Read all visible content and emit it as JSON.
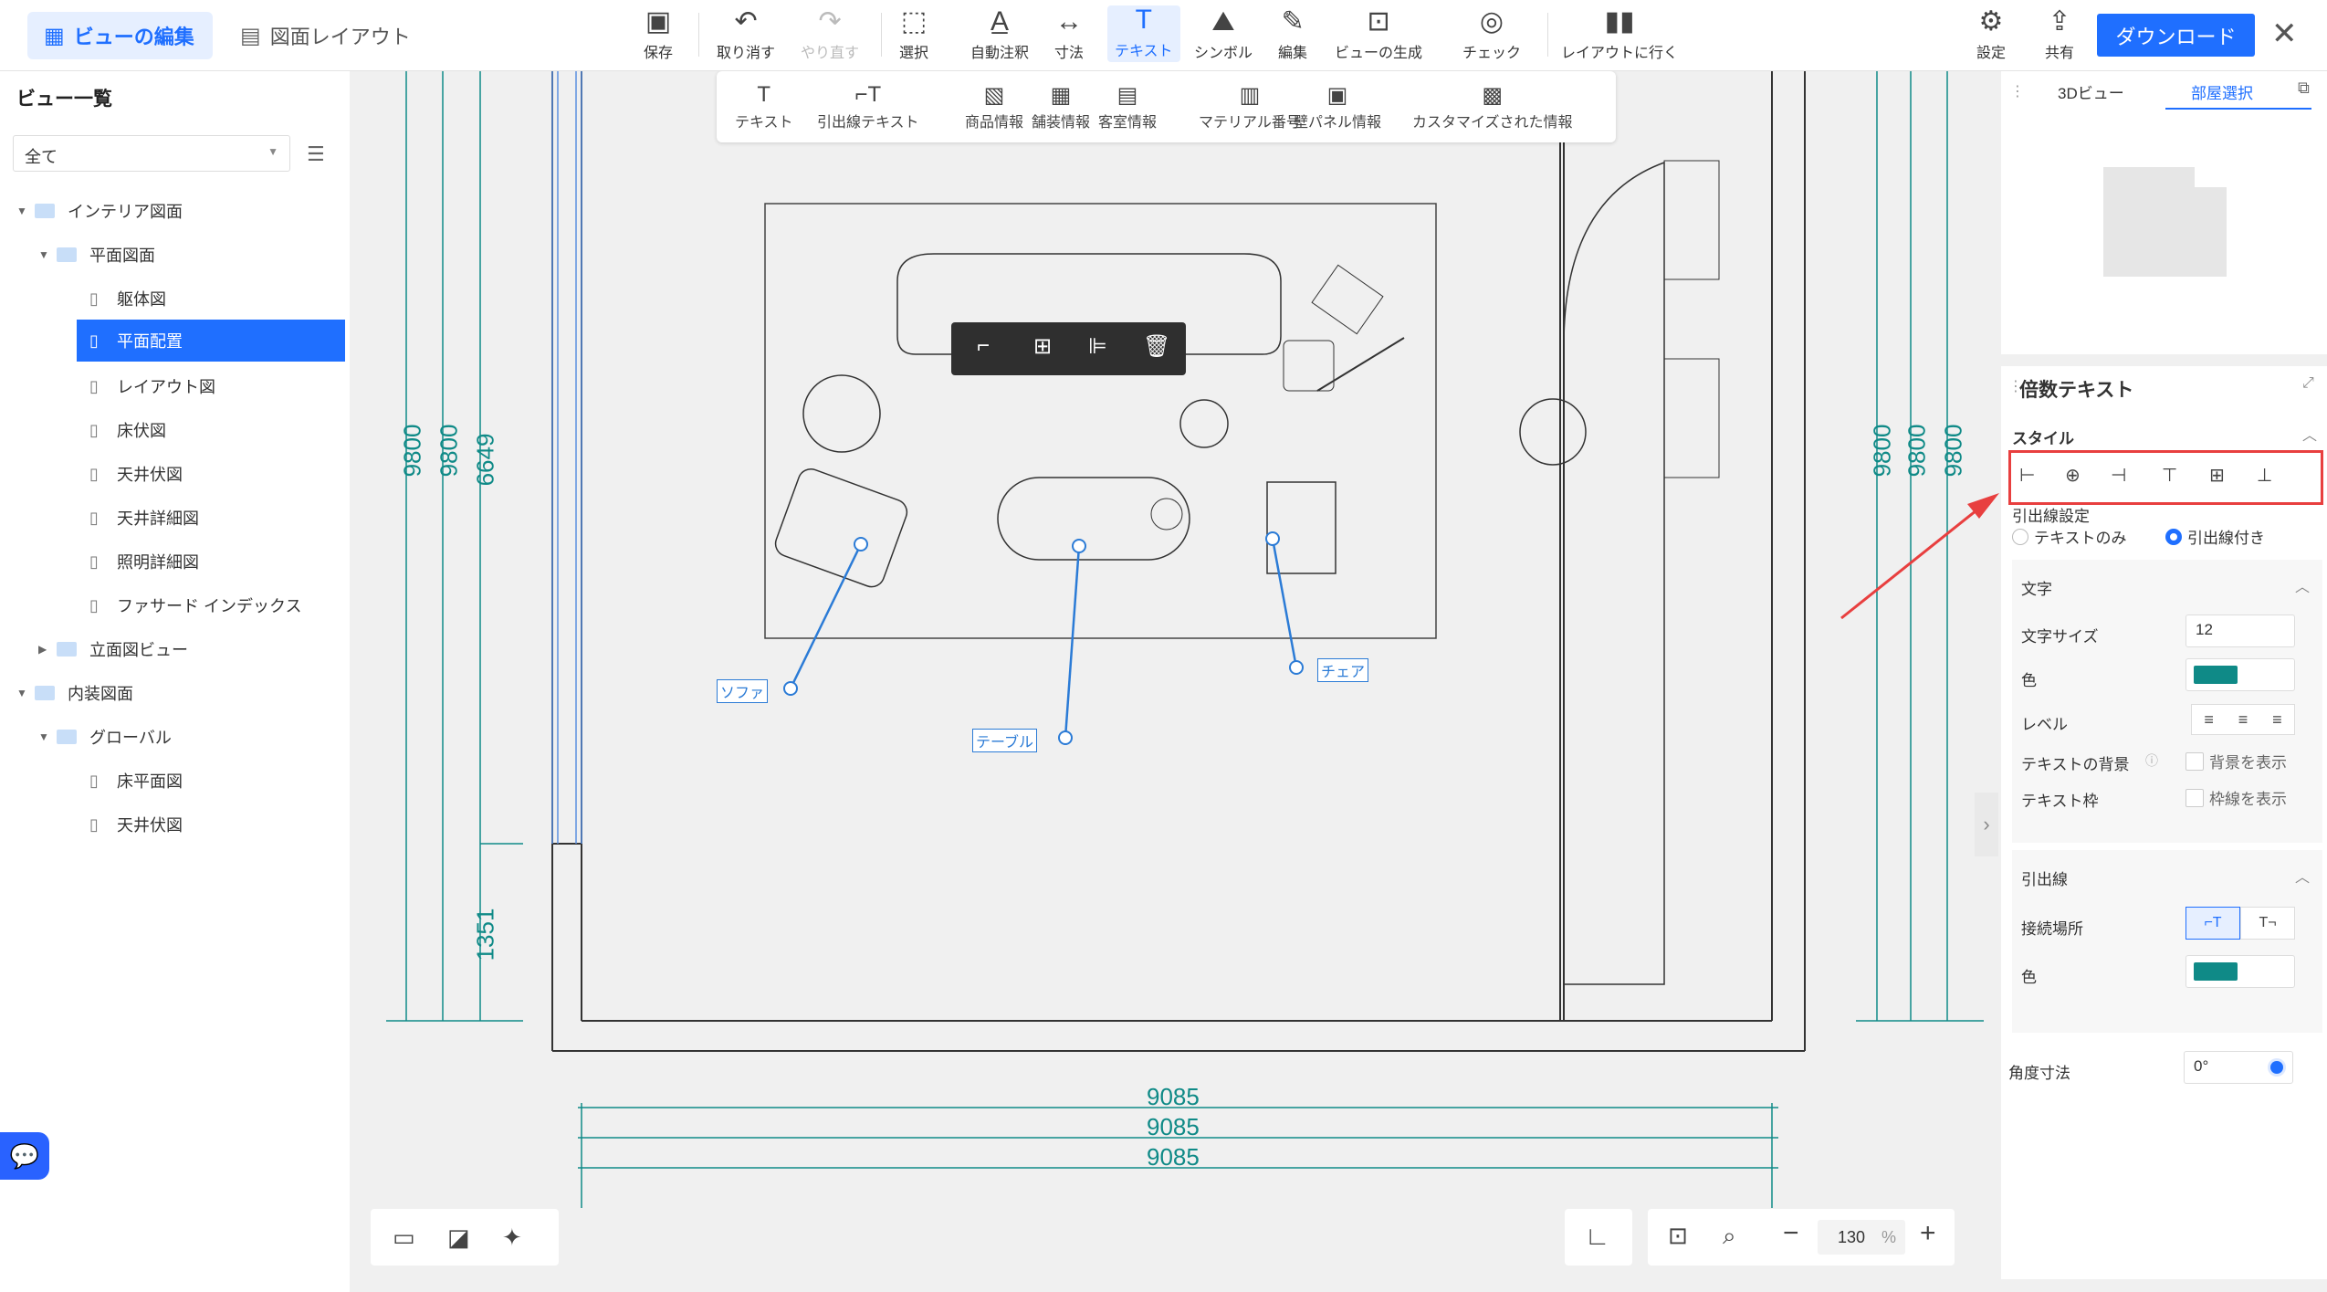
{
  "header": {
    "tab_edit": "ビューの編集",
    "tab_layout": "図面レイアウト",
    "tools": [
      "保存",
      "取り消す",
      "やり直す",
      "選択",
      "自動注釈",
      "寸法",
      "テキスト",
      "シンボル",
      "編集",
      "ビューの生成",
      "チェック",
      "レイアウトに行く"
    ],
    "settings": "設定",
    "share": "共有",
    "download": "ダウンロード"
  },
  "subtools": [
    "テキスト",
    "引出線テキスト",
    "商品情報",
    "舗装情報",
    "客室情報",
    "マテリアル番号",
    "壁パネル情報",
    "カスタマイズされた情報"
  ],
  "sidebar": {
    "title": "ビュー一覧",
    "filter": "全て",
    "items": [
      {
        "label": "インテリア図面",
        "type": "folder"
      },
      {
        "label": "平面図面",
        "type": "folder"
      },
      {
        "label": "躯体図",
        "type": "doc"
      },
      {
        "label": "平面配置",
        "type": "doc",
        "selected": true
      },
      {
        "label": "レイアウト図",
        "type": "doc"
      },
      {
        "label": "床伏図",
        "type": "doc"
      },
      {
        "label": "天井伏図",
        "type": "doc"
      },
      {
        "label": "天井詳細図",
        "type": "doc"
      },
      {
        "label": "照明詳細図",
        "type": "doc"
      },
      {
        "label": "ファサード インデックス",
        "type": "doc"
      },
      {
        "label": "立面図ビュー",
        "type": "folder"
      },
      {
        "label": "内装図面",
        "type": "folder"
      },
      {
        "label": "グローバル",
        "type": "folder"
      },
      {
        "label": "床平面図",
        "type": "doc"
      },
      {
        "label": "天井伏図",
        "type": "doc"
      }
    ]
  },
  "drawing": {
    "dims_left": [
      "9800",
      "9800",
      "6649",
      "1351"
    ],
    "dims_right": [
      "9800",
      "9800",
      "9800"
    ],
    "dims_bottom": [
      "9085",
      "9085",
      "9085"
    ],
    "labels": [
      "ソファ",
      "テーブル",
      "チェア"
    ],
    "line_color": "#0f8a87",
    "leader_color": "#2b7bd6"
  },
  "zoom": {
    "value": "130",
    "unit": "%"
  },
  "rightpanel": {
    "tab_3d": "3Dビュー",
    "tab_room": "部屋選択",
    "section_title": "倍数テキスト",
    "style": "スタイル",
    "leader_setting": "引出線設定",
    "radio_text_only": "テキストのみ",
    "radio_with_leader": "引出線付き",
    "char_section": "文字",
    "font_size_label": "文字サイズ",
    "font_size_value": "12",
    "color_label": "色",
    "level_label": "レベル",
    "bg_label": "テキストの背景",
    "bg_check": "背景を表示",
    "frame_label": "テキスト枠",
    "frame_check": "枠線を表示",
    "leader_section": "引出線",
    "connect_label": "接続場所",
    "color2_label": "色",
    "angle_label": "角度寸法",
    "angle_value": "0°",
    "accent_color": "#0f8a87"
  }
}
